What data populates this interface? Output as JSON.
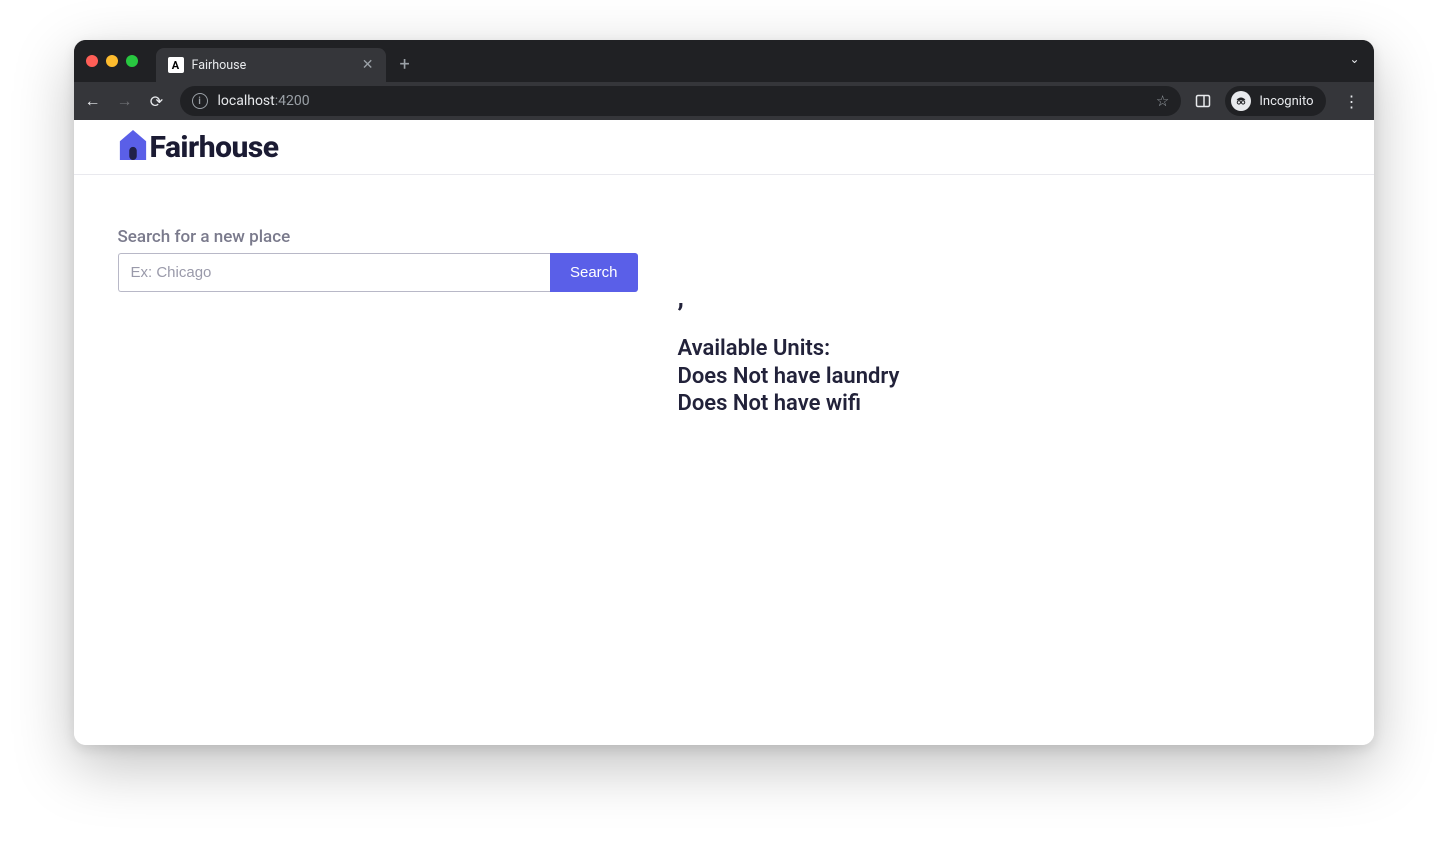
{
  "browser": {
    "tab": {
      "favicon_letter": "A",
      "title": "Fairhouse"
    },
    "url": {
      "host": "localhost",
      "port": ":4200"
    },
    "incognito_label": "Incognito"
  },
  "app": {
    "brand": "Fairhouse"
  },
  "search": {
    "label": "Search for a new place",
    "placeholder": "Ex: Chicago",
    "value": "",
    "button_label": "Search"
  },
  "details": {
    "heading_comma": ",",
    "available_units_label": "Available Units:",
    "laundry_line": "Does Not have laundry",
    "wifi_line": "Does Not have wifi"
  }
}
